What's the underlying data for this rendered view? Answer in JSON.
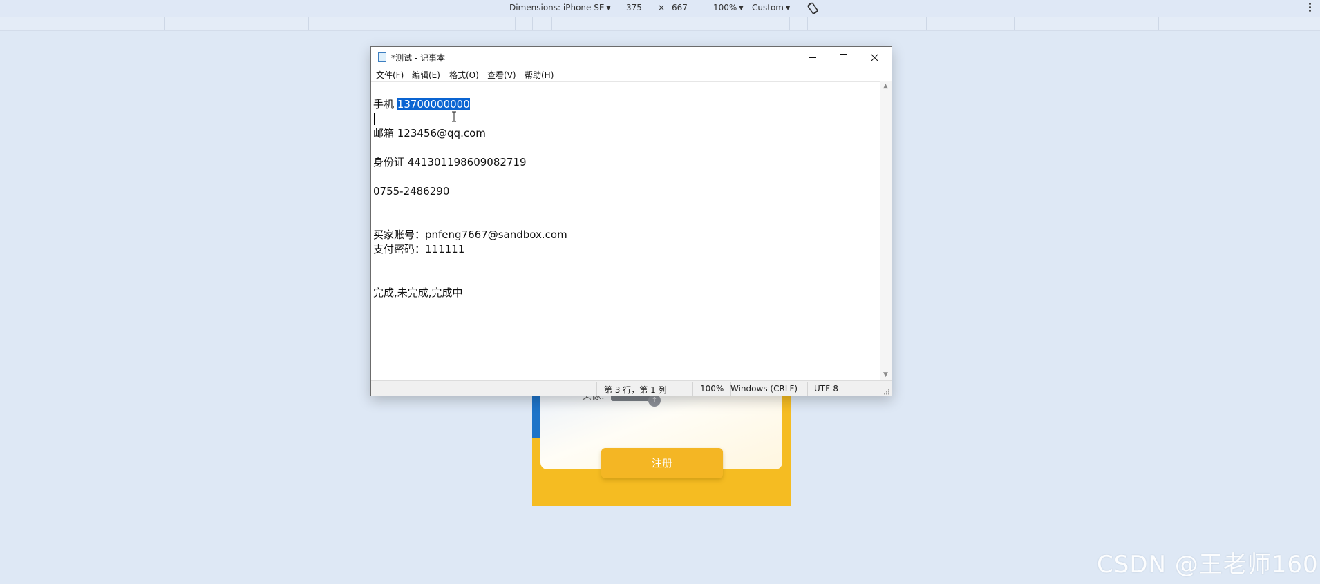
{
  "devtools": {
    "dimensions_label": "Dimensions: iPhone SE",
    "width": "375",
    "times": "×",
    "height": "667",
    "zoom": "100%",
    "throttle": "Custom"
  },
  "phone_page": {
    "avatar_label": "头像:",
    "register_button": "注册"
  },
  "notepad": {
    "title": "*测试 - 记事本",
    "menu": [
      "文件(F)",
      "编辑(E)",
      "格式(O)",
      "查看(V)",
      "帮助(H)"
    ],
    "lines": {
      "phone_label": "手机 ",
      "phone_value": "13700000000",
      "email": "邮箱 123456@qq.com",
      "id_card": "身份证 441301198609082719",
      "landline": "0755-2486290",
      "buyer_account": "买家账号：pnfeng7667@sandbox.com",
      "pay_password": "支付密码：111111",
      "statuses": "完成,未完成,完成中"
    },
    "status": {
      "position": "第 3 行，第 1 列",
      "zoom": "100%",
      "line_ending": "Windows (CRLF)",
      "encoding": "UTF-8"
    }
  },
  "watermark": "CSDN @王老师160"
}
